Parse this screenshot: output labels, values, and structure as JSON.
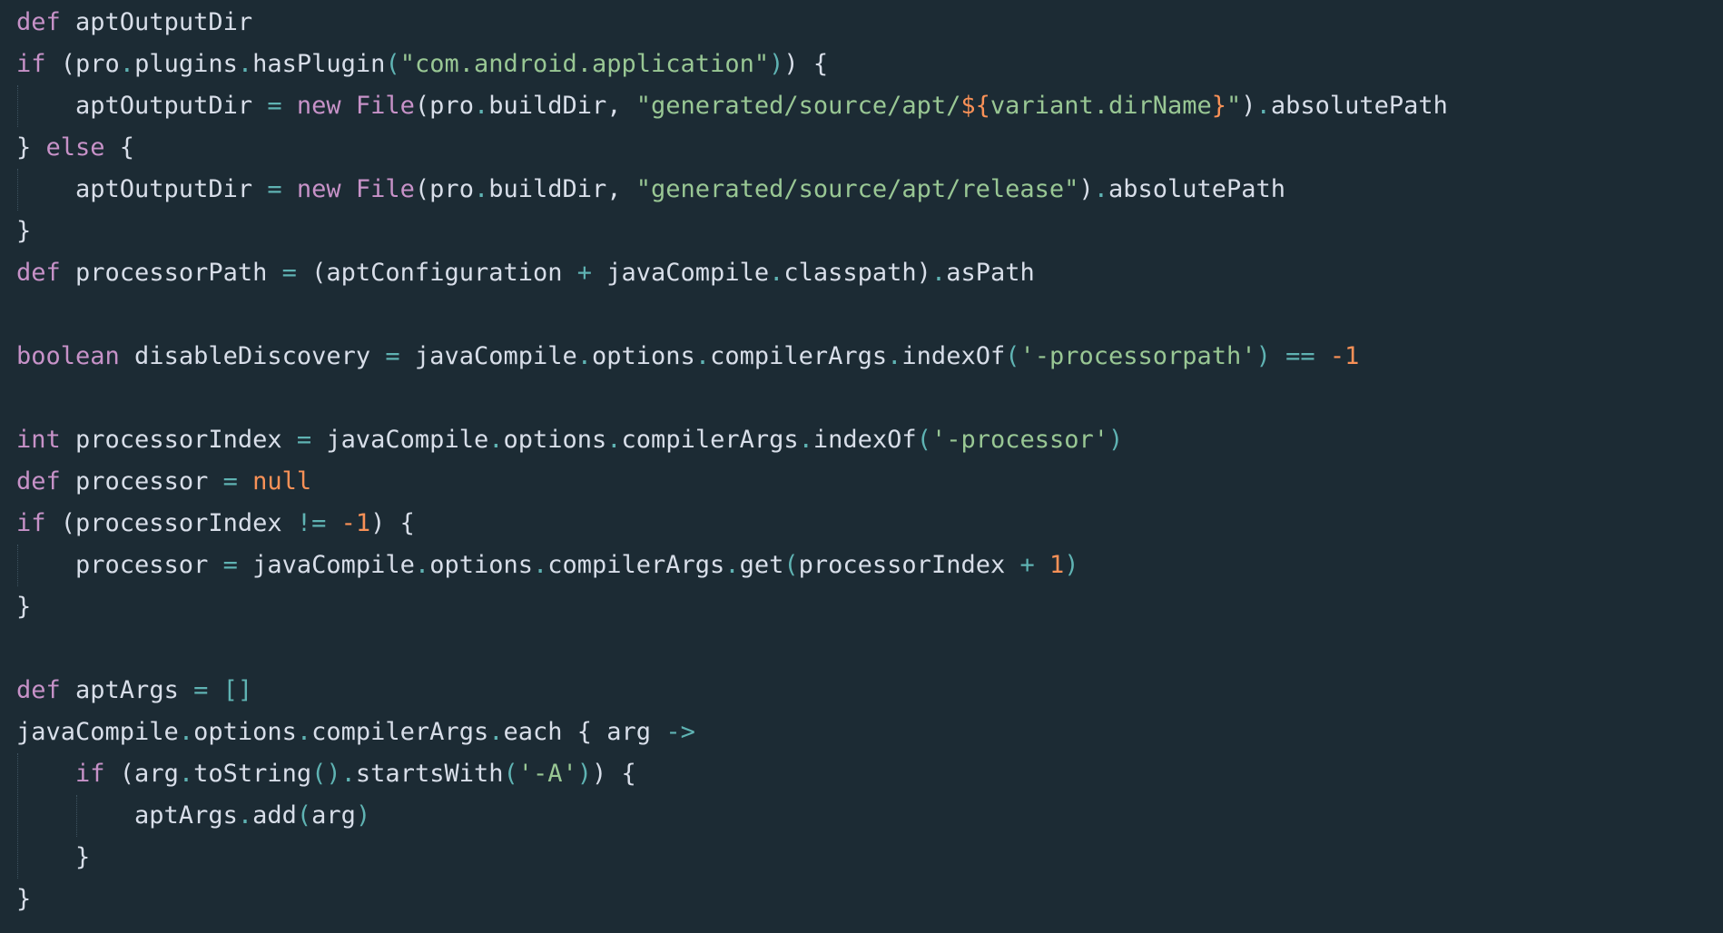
{
  "colors": {
    "background": "#1c2b34",
    "text": "#d8dee9",
    "keyword": "#c792c8",
    "operator": "#5fb3b3",
    "string": "#99c794",
    "number": "#f99157"
  },
  "code_lines": [
    [
      [
        "kw",
        "def"
      ],
      [
        "id",
        " aptOutputDir"
      ]
    ],
    [
      [
        "kw",
        "if"
      ],
      [
        "pu",
        " (pro"
      ],
      [
        "op",
        "."
      ],
      [
        "id",
        "plugins"
      ],
      [
        "op",
        "."
      ],
      [
        "id",
        "hasPlugin"
      ],
      [
        "op",
        "("
      ],
      [
        "str",
        "\"com.android.application\""
      ],
      [
        "op",
        ")"
      ],
      [
        "pu",
        ") {"
      ]
    ],
    [
      [
        "id",
        "    aptOutputDir "
      ],
      [
        "op",
        "="
      ],
      [
        "kw",
        " new"
      ],
      [
        "cls",
        " File"
      ],
      [
        "pu",
        "(pro"
      ],
      [
        "op",
        "."
      ],
      [
        "id",
        "buildDir, "
      ],
      [
        "str",
        "\"generated/source/apt/"
      ],
      [
        "num",
        "${"
      ],
      [
        "str",
        "variant.dirName"
      ],
      [
        "num",
        "}"
      ],
      [
        "str",
        "\""
      ],
      [
        "pu",
        ")"
      ],
      [
        "op",
        "."
      ],
      [
        "id",
        "absolutePath"
      ]
    ],
    [
      [
        "pu",
        "} "
      ],
      [
        "kw",
        "else"
      ],
      [
        "pu",
        " {"
      ]
    ],
    [
      [
        "id",
        "    aptOutputDir "
      ],
      [
        "op",
        "="
      ],
      [
        "kw",
        " new"
      ],
      [
        "cls",
        " File"
      ],
      [
        "pu",
        "(pro"
      ],
      [
        "op",
        "."
      ],
      [
        "id",
        "buildDir, "
      ],
      [
        "str",
        "\"generated/source/apt/release\""
      ],
      [
        "pu",
        ")"
      ],
      [
        "op",
        "."
      ],
      [
        "id",
        "absolutePath"
      ]
    ],
    [
      [
        "pu",
        "}"
      ]
    ],
    [
      [
        "kw",
        "def"
      ],
      [
        "id",
        " processorPath "
      ],
      [
        "op",
        "="
      ],
      [
        "pu",
        " (aptConfiguration "
      ],
      [
        "op",
        "+"
      ],
      [
        "id",
        " javaCompile"
      ],
      [
        "op",
        "."
      ],
      [
        "id",
        "classpath)"
      ],
      [
        "op",
        "."
      ],
      [
        "id",
        "asPath"
      ]
    ],
    [],
    [
      [
        "kw",
        "boolean"
      ],
      [
        "id",
        " disableDiscovery "
      ],
      [
        "op",
        "="
      ],
      [
        "id",
        " javaCompile"
      ],
      [
        "op",
        "."
      ],
      [
        "id",
        "options"
      ],
      [
        "op",
        "."
      ],
      [
        "id",
        "compilerArgs"
      ],
      [
        "op",
        "."
      ],
      [
        "id",
        "indexOf"
      ],
      [
        "op",
        "("
      ],
      [
        "str",
        "'-processorpath'"
      ],
      [
        "op",
        ")"
      ],
      [
        "op",
        " =="
      ],
      [
        "num",
        " -1"
      ]
    ],
    [],
    [
      [
        "kw",
        "int"
      ],
      [
        "id",
        " processorIndex "
      ],
      [
        "op",
        "="
      ],
      [
        "id",
        " javaCompile"
      ],
      [
        "op",
        "."
      ],
      [
        "id",
        "options"
      ],
      [
        "op",
        "."
      ],
      [
        "id",
        "compilerArgs"
      ],
      [
        "op",
        "."
      ],
      [
        "id",
        "indexOf"
      ],
      [
        "op",
        "("
      ],
      [
        "str",
        "'-processor'"
      ],
      [
        "op",
        ")"
      ]
    ],
    [
      [
        "kw",
        "def"
      ],
      [
        "id",
        " processor "
      ],
      [
        "op",
        "="
      ],
      [
        "num",
        " null"
      ]
    ],
    [
      [
        "kw",
        "if"
      ],
      [
        "pu",
        " (processorIndex "
      ],
      [
        "op",
        "!="
      ],
      [
        "num",
        " -1"
      ],
      [
        "pu",
        ") {"
      ]
    ],
    [
      [
        "id",
        "    processor "
      ],
      [
        "op",
        "="
      ],
      [
        "id",
        " javaCompile"
      ],
      [
        "op",
        "."
      ],
      [
        "id",
        "options"
      ],
      [
        "op",
        "."
      ],
      [
        "id",
        "compilerArgs"
      ],
      [
        "op",
        "."
      ],
      [
        "id",
        "get"
      ],
      [
        "op",
        "("
      ],
      [
        "id",
        "processorIndex "
      ],
      [
        "op",
        "+"
      ],
      [
        "num",
        " 1"
      ],
      [
        "op",
        ")"
      ]
    ],
    [
      [
        "pu",
        "}"
      ]
    ],
    [],
    [
      [
        "kw",
        "def"
      ],
      [
        "id",
        " aptArgs "
      ],
      [
        "op",
        "="
      ],
      [
        "op",
        " []"
      ]
    ],
    [
      [
        "id",
        "javaCompile"
      ],
      [
        "op",
        "."
      ],
      [
        "id",
        "options"
      ],
      [
        "op",
        "."
      ],
      [
        "id",
        "compilerArgs"
      ],
      [
        "op",
        "."
      ],
      [
        "id",
        "each"
      ],
      [
        "pu",
        " { arg "
      ],
      [
        "op",
        "->"
      ]
    ],
    [
      [
        "kw",
        "    if"
      ],
      [
        "pu",
        " (arg"
      ],
      [
        "op",
        "."
      ],
      [
        "id",
        "toString"
      ],
      [
        "op",
        "()"
      ],
      [
        "op",
        "."
      ],
      [
        "id",
        "startsWith"
      ],
      [
        "op",
        "("
      ],
      [
        "str",
        "'-A'"
      ],
      [
        "op",
        ")"
      ],
      [
        "pu",
        ") {"
      ]
    ],
    [
      [
        "id",
        "        aptArgs"
      ],
      [
        "op",
        "."
      ],
      [
        "id",
        "add"
      ],
      [
        "op",
        "("
      ],
      [
        "id",
        "arg"
      ],
      [
        "op",
        ")"
      ]
    ],
    [
      [
        "pu",
        "    }"
      ]
    ],
    [
      [
        "pu",
        "}"
      ]
    ]
  ]
}
